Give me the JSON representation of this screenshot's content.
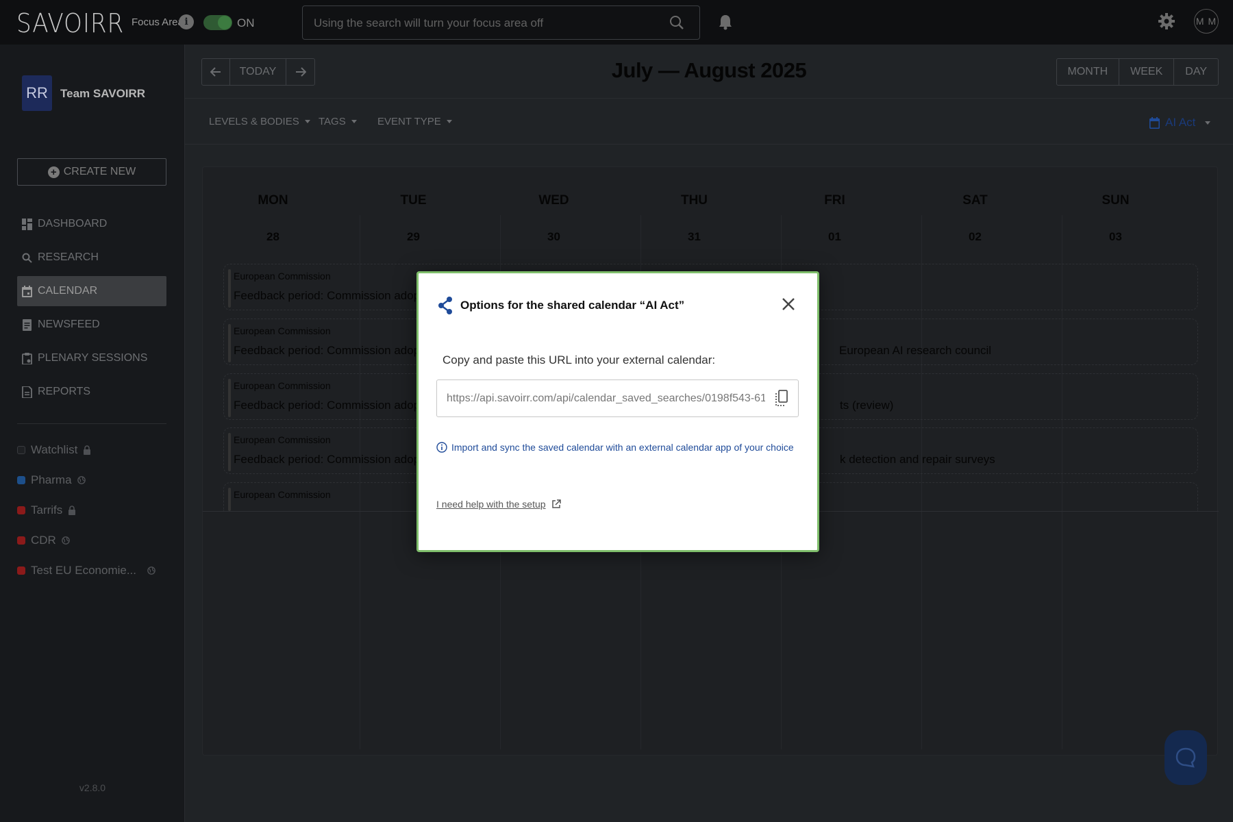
{
  "topbar": {
    "logo": "SAVOIRR",
    "focus_label": "Focus Area",
    "info_glyph": "i",
    "toggle_state": "ON",
    "search_placeholder": "Using the search will turn your focus area off",
    "avatar_initials": "M M",
    "icons": [
      "info-icon",
      "search-icon",
      "bell-icon",
      "gear-icon"
    ]
  },
  "sidebar": {
    "team_logo": "RR",
    "team_name": "Team SAVOIRR",
    "create_label": "CREATE NEW",
    "nav": [
      {
        "label": "DASHBOARD",
        "icon": "dashboard-icon"
      },
      {
        "label": "RESEARCH",
        "icon": "search-icon"
      },
      {
        "label": "CALENDAR",
        "icon": "calendar-icon",
        "active": true
      },
      {
        "label": "NEWSFEED",
        "icon": "document-icon"
      },
      {
        "label": "PLENARY SESSIONS",
        "icon": "clipboard-icon"
      },
      {
        "label": "REPORTS",
        "icon": "report-icon"
      }
    ],
    "watchlists": [
      {
        "label": "Watchlist",
        "color": "#1e2023",
        "icon": "lock-icon"
      },
      {
        "label": "Pharma",
        "color": "#1d4f8a",
        "icon": "globe-icon"
      },
      {
        "label": "Tarrifs",
        "color": "#8b1a1a",
        "icon": "lock-icon"
      },
      {
        "label": "CDR",
        "color": "#8b1a1a",
        "icon": "globe-icon"
      },
      {
        "label": "Test EU Economie...",
        "color": "#8b1a1a",
        "icon": "globe-icon"
      }
    ],
    "version": "v2.8.0"
  },
  "calendar": {
    "today_label": "TODAY",
    "title": "July — August 2025",
    "views": [
      "MONTH",
      "WEEK",
      "DAY"
    ],
    "filters": [
      "LEVELS & BODIES",
      "TAGS",
      "EVENT TYPE"
    ],
    "saved_calendar": "AI Act",
    "days": [
      {
        "name": "MON",
        "num": "28"
      },
      {
        "name": "TUE",
        "num": "29"
      },
      {
        "name": "WED",
        "num": "30"
      },
      {
        "name": "THU",
        "num": "31"
      },
      {
        "name": "FRI",
        "num": "01"
      },
      {
        "name": "SAT",
        "num": "02"
      },
      {
        "name": "SUN",
        "num": "03"
      }
    ],
    "events": [
      {
        "org": "European Commission",
        "title": "Feedback period: Commission adoption",
        "tail": ""
      },
      {
        "org": "European Commission",
        "title": "Feedback period: Commission adoption",
        "tail": "European AI research council"
      },
      {
        "org": "European Commission",
        "title": "Feedback period: Commission adoption",
        "tail": "ts (review)"
      },
      {
        "org": "European Commission",
        "title": "Feedback period: Commission adoption",
        "tail": "k detection and repair surveys"
      },
      {
        "org": "European Commission",
        "title": "",
        "tail": ""
      }
    ]
  },
  "modal": {
    "title": "Options for the shared calendar “AI Act”",
    "instruction": "Copy and paste this URL into your external calendar:",
    "url": "https://api.savoirr.com/api/calendar_saved_searches/0198f543-61...",
    "info": "Import and sync the saved calendar with an external calendar app of your choice",
    "help_link": "I need help with the setup",
    "colors": {
      "accent": "#1f4b99",
      "border": "#7fbe6b"
    }
  }
}
